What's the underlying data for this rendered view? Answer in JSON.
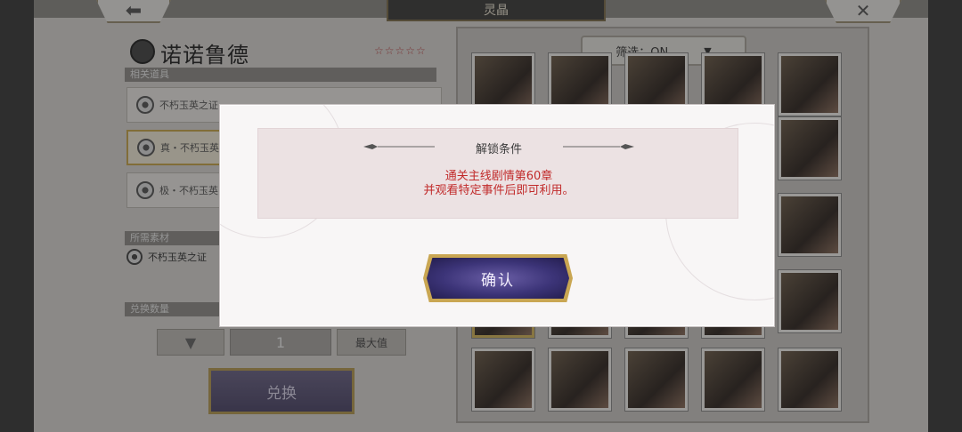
{
  "header": {
    "title": "灵晶",
    "back_icon": "arrow-left-icon",
    "close_icon": "close-icon"
  },
  "character": {
    "name": "诺诺鲁德",
    "stars": "☆☆☆☆☆"
  },
  "left_panel": {
    "related_items_label": "相关道具",
    "items": [
      {
        "label": "不朽玉英之证"
      },
      {
        "label": "真・不朽玉英"
      },
      {
        "label": "极・不朽玉英"
      }
    ],
    "materials_label": "所需素材",
    "material": "不朽玉英之证",
    "quantity_label": "兑换数量",
    "quantity_value": "1",
    "max_label": "最大值",
    "exchange_label": "兑换"
  },
  "right_panel": {
    "filter_label": "筛选：ON"
  },
  "modal": {
    "title": "解锁条件",
    "line1": "通关主线剧情第60章",
    "line2": "并观看特定事件后即可利用。",
    "confirm_label": "确认"
  },
  "colors": {
    "accent_gold": "#c9a652",
    "button_purple": "#3c3478",
    "condition_red": "#c12a2a"
  }
}
